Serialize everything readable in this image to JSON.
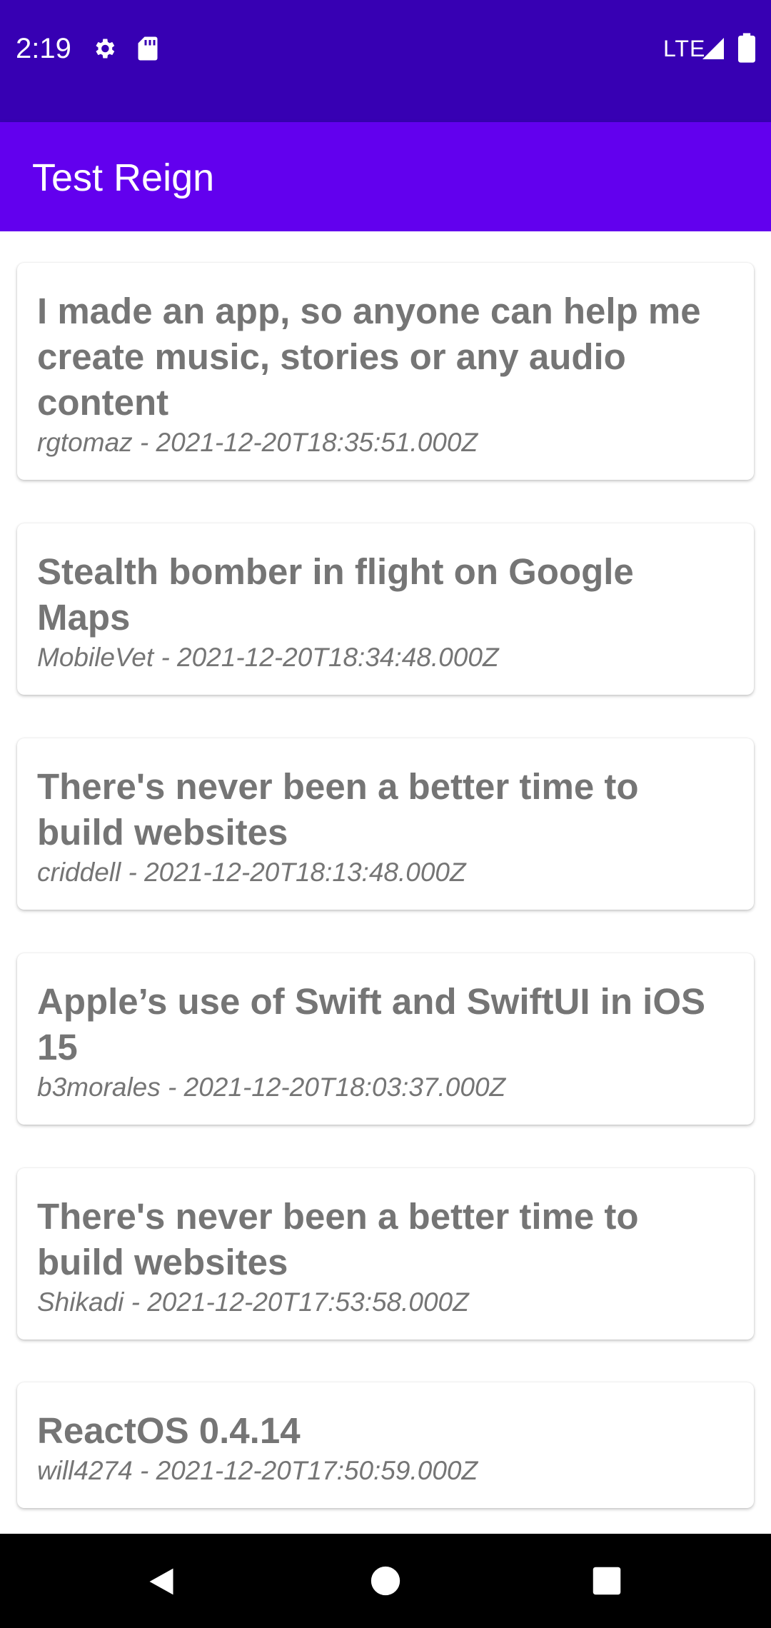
{
  "status_bar": {
    "time": "2:19",
    "network": "LTE",
    "icons": [
      "gear-icon",
      "sd-card-icon",
      "signal-icon",
      "battery-icon"
    ]
  },
  "app_bar": {
    "title": "Test Reign"
  },
  "stories": [
    {
      "title": "I made an app, so anyone can help me create music, stories or any audio content",
      "meta": "rgtomaz - 2021-12-20T18:35:51.000Z"
    },
    {
      "title": "Stealth bomber in flight on Google Maps",
      "meta": "MobileVet - 2021-12-20T18:34:48.000Z"
    },
    {
      "title": "There's never been a better time to build websites",
      "meta": "criddell - 2021-12-20T18:13:48.000Z"
    },
    {
      "title": "Apple’s use of Swift and SwiftUI in iOS 15",
      "meta": "b3morales - 2021-12-20T18:03:37.000Z"
    },
    {
      "title": "There's never been a better time to build websites",
      "meta": "Shikadi - 2021-12-20T17:53:58.000Z"
    },
    {
      "title": "ReactOS 0.4.14",
      "meta": "will4274 - 2021-12-20T17:50:59.000Z"
    }
  ],
  "nav_bar": {
    "icons": [
      "back-icon",
      "home-icon",
      "recents-icon"
    ]
  },
  "colors": {
    "status_bar": "#3700b3",
    "app_bar": "#6200ee",
    "card_text": "#757575",
    "nav_bar": "#000000"
  }
}
